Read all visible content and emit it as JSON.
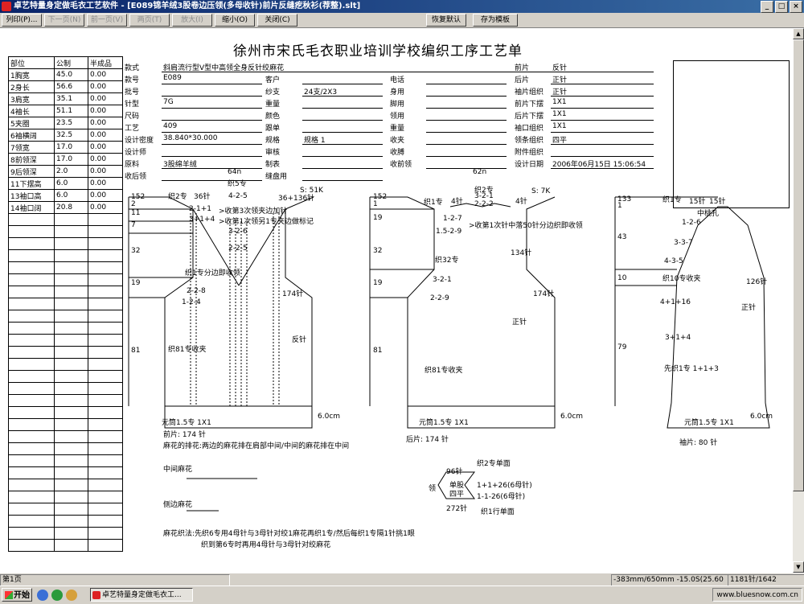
{
  "window": {
    "title": "卓艺特量身定做毛衣工艺软件 - [E089锦羊绒3股卷边压领(多母收针)前片反缝疙秋衫(荐整).slt]",
    "controls": [
      "_",
      "□",
      "×"
    ]
  },
  "toolbar": {
    "buttons": [
      {
        "label": "列印(P)...",
        "enabled": true
      },
      {
        "label": "下一页(N)",
        "enabled": false
      },
      {
        "label": "前一页(V)",
        "enabled": false
      },
      {
        "label": "两页(T)",
        "enabled": false
      },
      {
        "label": "放大(I)",
        "enabled": false
      },
      {
        "label": "缩小(O)",
        "enabled": true
      },
      {
        "label": "关闭(C)",
        "enabled": true
      },
      {
        "label": "恢复默认",
        "enabled": true
      },
      {
        "label": "存为模板",
        "enabled": true
      }
    ]
  },
  "sheet": {
    "title": "徐州市宋氏毛衣职业培训学校编织工序工艺单",
    "size_table": {
      "headers": [
        "部位",
        "公制",
        "半成品"
      ],
      "rows": [
        [
          "1胸宽",
          "45.0",
          "0.00"
        ],
        [
          "2身长",
          "56.6",
          "0.00"
        ],
        [
          "3肩宽",
          "35.1",
          "0.00"
        ],
        [
          "4袖长",
          "51.1",
          "0.00"
        ],
        [
          "5夹圈",
          "23.5",
          "0.00"
        ],
        [
          "6袖横阔",
          "32.5",
          "0.00"
        ],
        [
          "7领宽",
          "17.0",
          "0.00"
        ],
        [
          "8前领深",
          "17.0",
          "0.00"
        ],
        [
          "9后领深",
          "2.0",
          "0.00"
        ],
        [
          "11下摆高",
          "6.0",
          "0.00"
        ],
        [
          "13袖口高",
          "6.0",
          "0.00"
        ],
        [
          "14袖口阔",
          "20.8",
          "0.00"
        ]
      ]
    },
    "info": [
      {
        "label": "款式",
        "value": "斜肩流行型V型中高领全身反针绞麻花"
      },
      {
        "label": "款号",
        "value": "E089"
      },
      {
        "label": "批号",
        "value": ""
      },
      {
        "label": "针型",
        "value": "7G"
      },
      {
        "label": "尺码",
        "value": ""
      },
      {
        "label": "工艺",
        "value": "409"
      },
      {
        "label": "设计密度",
        "value": "38.840*30.000"
      },
      {
        "label": "设计师",
        "value": ""
      },
      {
        "label": "原料",
        "value": "3股绵羊绒"
      },
      {
        "label": "收后领",
        "value": ""
      }
    ],
    "info_mid": [
      {
        "label": "客户",
        "value": ""
      },
      {
        "label": "纱支",
        "value": "24支/2X3"
      },
      {
        "label": "重量",
        "value": ""
      },
      {
        "label": "颜色",
        "value": ""
      },
      {
        "label": "跟单",
        "value": ""
      },
      {
        "label": "规格",
        "value": "规格 1"
      },
      {
        "label": "审核",
        "value": ""
      },
      {
        "label": "制表",
        "value": ""
      },
      {
        "label": "缝盘用",
        "value": ""
      }
    ],
    "info_right_labels": [
      "电话",
      "身用",
      "脚用",
      "领用",
      "重量",
      "收夹",
      "收膊",
      "收前领"
    ],
    "info_far": [
      {
        "label": "前片",
        "value": "反针"
      },
      {
        "label": "后片",
        "value": "正针"
      },
      {
        "label": "袖片组织",
        "value": "正针"
      },
      {
        "label": "前片下摆",
        "value": "1X1"
      },
      {
        "label": "后片下摆",
        "value": "1X1"
      },
      {
        "label": "袖口组织",
        "value": "1X1"
      },
      {
        "label": "领条组织",
        "value": "四平"
      },
      {
        "label": "附件组织",
        "value": ""
      },
      {
        "label": "设计日期",
        "value": "2006年06月15日 15:06:54"
      }
    ],
    "front": {
      "caption": "前片: 174 针",
      "top_cm": "64n",
      "labels": [
        "152",
        "2",
        "11",
        "7",
        "32",
        "19",
        "81",
        "织2专",
        "36针",
        "4-2-5",
        "36+136针",
        "S: 51K",
        "织5专",
        "2-1+1",
        "3+1+4",
        ">收第3次领夹边加针",
        ">收第1次领另1专夹边做标记",
        "3-2-6",
        "2-2-5",
        "织1专分边即收领",
        "2-2-8",
        "1-2-4",
        "174针",
        "反针",
        "织81专收夹",
        "元筒1.5专 1X1",
        "6.0cm"
      ]
    },
    "back": {
      "caption": "后片: 174 针",
      "top_cm": "62n",
      "labels": [
        "152",
        "1",
        "19",
        "32",
        "19",
        "81",
        "织1专",
        "4针",
        "织2专",
        "3-2-1",
        "2-2-2",
        "4针",
        "S: 7K",
        "1-2-7",
        ">收第1次针中落50针分边织即收领",
        "1.5-2-9",
        "134针",
        "织32专",
        "3-2-1",
        "2-2-9",
        "174针",
        "正针",
        "织81专收夹",
        "元筒1.5专 1X1",
        "6.0cm"
      ]
    },
    "sleeve": {
      "caption": "袖片: 80 针",
      "labels": [
        "133",
        "1",
        "43",
        "10",
        "79",
        "织1专",
        "15针",
        "15针",
        "中桃孔",
        "1-2-6",
        "3-3-7",
        "4-3-5",
        "织10专收夹",
        "126针",
        "4+1+16",
        "正针",
        "3+1+4",
        "先织1专 1+1+3",
        "元筒1.5专 1X1",
        "6.0cm"
      ]
    },
    "notes": {
      "mahua_layout": "麻花的排花:两边的麻花排在肩部中间/中间的麻花排在中间",
      "center_mahua": "中间麻花",
      "side_mahua": "侧边麻花",
      "mahua_method_1": "麻花织法:先织6专用4母针与3母针对绞1麻花再织1专/然后每织1专隔1针挑1眼",
      "mahua_method_2": "织到第6专时再用4母针与3母针对绞麻花"
    },
    "collar": {
      "top_count": "96针",
      "top_note": "织2专单面",
      "label": "领",
      "mid1": "单股",
      "mid2": "四平",
      "f1": "1+1+26(6母针)",
      "f2": "1-1-26(6母针)",
      "bottom_count": "272针",
      "bottom_note": "织1行单面"
    }
  },
  "status": {
    "page": "第1页",
    "coords": "-383mm/650mm  -15.0S(25.60",
    "right": "1181针/1642"
  },
  "taskbar": {
    "start": "开始",
    "task": "卓艺特量身定做毛衣工...",
    "watermark": "www.bluesnow.com.cn"
  }
}
